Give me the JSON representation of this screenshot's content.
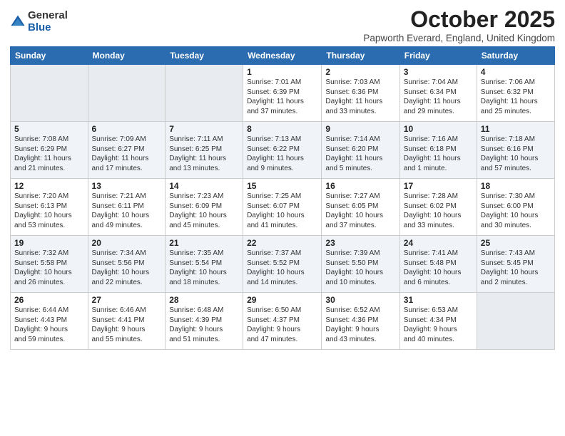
{
  "logo": {
    "general": "General",
    "blue": "Blue"
  },
  "title": "October 2025",
  "location": "Papworth Everard, England, United Kingdom",
  "days_of_week": [
    "Sunday",
    "Monday",
    "Tuesday",
    "Wednesday",
    "Thursday",
    "Friday",
    "Saturday"
  ],
  "weeks": [
    [
      {
        "day": "",
        "info": ""
      },
      {
        "day": "",
        "info": ""
      },
      {
        "day": "",
        "info": ""
      },
      {
        "day": "1",
        "info": "Sunrise: 7:01 AM\nSunset: 6:39 PM\nDaylight: 11 hours\nand 37 minutes."
      },
      {
        "day": "2",
        "info": "Sunrise: 7:03 AM\nSunset: 6:36 PM\nDaylight: 11 hours\nand 33 minutes."
      },
      {
        "day": "3",
        "info": "Sunrise: 7:04 AM\nSunset: 6:34 PM\nDaylight: 11 hours\nand 29 minutes."
      },
      {
        "day": "4",
        "info": "Sunrise: 7:06 AM\nSunset: 6:32 PM\nDaylight: 11 hours\nand 25 minutes."
      }
    ],
    [
      {
        "day": "5",
        "info": "Sunrise: 7:08 AM\nSunset: 6:29 PM\nDaylight: 11 hours\nand 21 minutes."
      },
      {
        "day": "6",
        "info": "Sunrise: 7:09 AM\nSunset: 6:27 PM\nDaylight: 11 hours\nand 17 minutes."
      },
      {
        "day": "7",
        "info": "Sunrise: 7:11 AM\nSunset: 6:25 PM\nDaylight: 11 hours\nand 13 minutes."
      },
      {
        "day": "8",
        "info": "Sunrise: 7:13 AM\nSunset: 6:22 PM\nDaylight: 11 hours\nand 9 minutes."
      },
      {
        "day": "9",
        "info": "Sunrise: 7:14 AM\nSunset: 6:20 PM\nDaylight: 11 hours\nand 5 minutes."
      },
      {
        "day": "10",
        "info": "Sunrise: 7:16 AM\nSunset: 6:18 PM\nDaylight: 11 hours\nand 1 minute."
      },
      {
        "day": "11",
        "info": "Sunrise: 7:18 AM\nSunset: 6:16 PM\nDaylight: 10 hours\nand 57 minutes."
      }
    ],
    [
      {
        "day": "12",
        "info": "Sunrise: 7:20 AM\nSunset: 6:13 PM\nDaylight: 10 hours\nand 53 minutes."
      },
      {
        "day": "13",
        "info": "Sunrise: 7:21 AM\nSunset: 6:11 PM\nDaylight: 10 hours\nand 49 minutes."
      },
      {
        "day": "14",
        "info": "Sunrise: 7:23 AM\nSunset: 6:09 PM\nDaylight: 10 hours\nand 45 minutes."
      },
      {
        "day": "15",
        "info": "Sunrise: 7:25 AM\nSunset: 6:07 PM\nDaylight: 10 hours\nand 41 minutes."
      },
      {
        "day": "16",
        "info": "Sunrise: 7:27 AM\nSunset: 6:05 PM\nDaylight: 10 hours\nand 37 minutes."
      },
      {
        "day": "17",
        "info": "Sunrise: 7:28 AM\nSunset: 6:02 PM\nDaylight: 10 hours\nand 33 minutes."
      },
      {
        "day": "18",
        "info": "Sunrise: 7:30 AM\nSunset: 6:00 PM\nDaylight: 10 hours\nand 30 minutes."
      }
    ],
    [
      {
        "day": "19",
        "info": "Sunrise: 7:32 AM\nSunset: 5:58 PM\nDaylight: 10 hours\nand 26 minutes."
      },
      {
        "day": "20",
        "info": "Sunrise: 7:34 AM\nSunset: 5:56 PM\nDaylight: 10 hours\nand 22 minutes."
      },
      {
        "day": "21",
        "info": "Sunrise: 7:35 AM\nSunset: 5:54 PM\nDaylight: 10 hours\nand 18 minutes."
      },
      {
        "day": "22",
        "info": "Sunrise: 7:37 AM\nSunset: 5:52 PM\nDaylight: 10 hours\nand 14 minutes."
      },
      {
        "day": "23",
        "info": "Sunrise: 7:39 AM\nSunset: 5:50 PM\nDaylight: 10 hours\nand 10 minutes."
      },
      {
        "day": "24",
        "info": "Sunrise: 7:41 AM\nSunset: 5:48 PM\nDaylight: 10 hours\nand 6 minutes."
      },
      {
        "day": "25",
        "info": "Sunrise: 7:43 AM\nSunset: 5:45 PM\nDaylight: 10 hours\nand 2 minutes."
      }
    ],
    [
      {
        "day": "26",
        "info": "Sunrise: 6:44 AM\nSunset: 4:43 PM\nDaylight: 9 hours\nand 59 minutes."
      },
      {
        "day": "27",
        "info": "Sunrise: 6:46 AM\nSunset: 4:41 PM\nDaylight: 9 hours\nand 55 minutes."
      },
      {
        "day": "28",
        "info": "Sunrise: 6:48 AM\nSunset: 4:39 PM\nDaylight: 9 hours\nand 51 minutes."
      },
      {
        "day": "29",
        "info": "Sunrise: 6:50 AM\nSunset: 4:37 PM\nDaylight: 9 hours\nand 47 minutes."
      },
      {
        "day": "30",
        "info": "Sunrise: 6:52 AM\nSunset: 4:36 PM\nDaylight: 9 hours\nand 43 minutes."
      },
      {
        "day": "31",
        "info": "Sunrise: 6:53 AM\nSunset: 4:34 PM\nDaylight: 9 hours\nand 40 minutes."
      },
      {
        "day": "",
        "info": ""
      }
    ]
  ]
}
